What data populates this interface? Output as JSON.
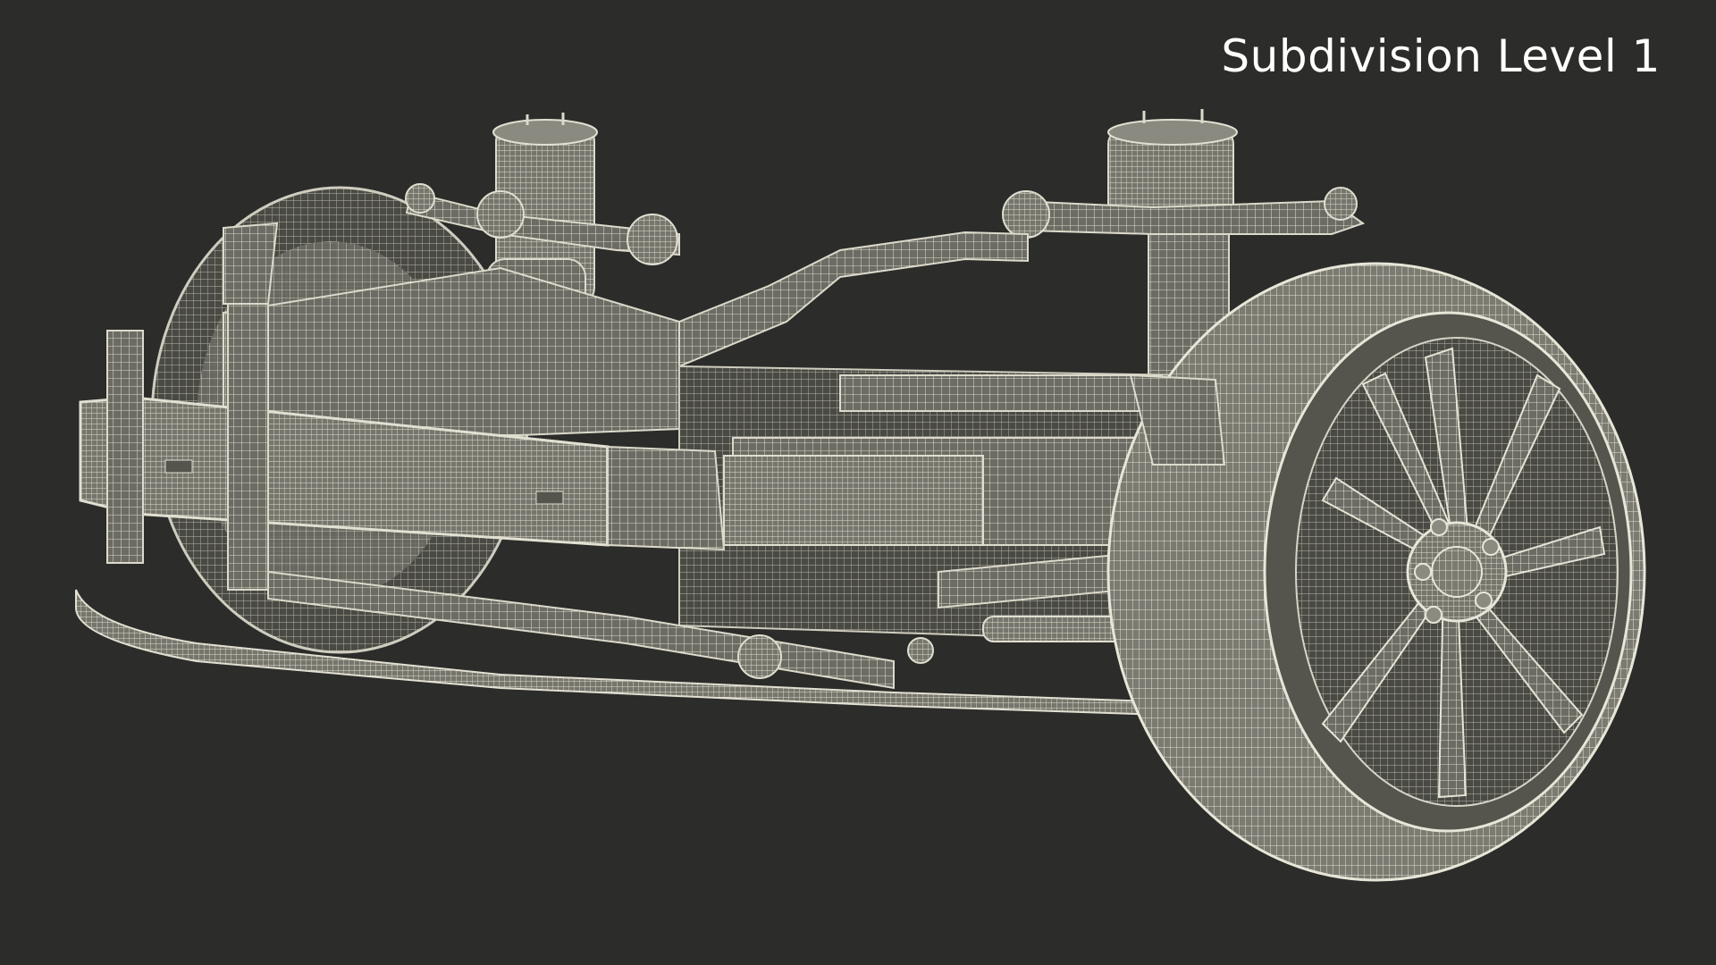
{
  "overlay": {
    "subdivision_label": "Subdivision Level 1"
  },
  "scene": {
    "subject": "front-suspension-wireframe-model",
    "background_color": "#2c2c2a",
    "wire_color": "#d8d6c8",
    "surface_color": "#6b6b63",
    "shadow_color": "#45453f"
  }
}
